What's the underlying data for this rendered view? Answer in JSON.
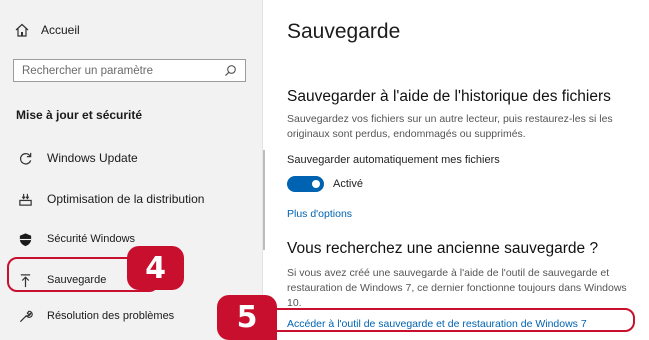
{
  "sidebar": {
    "home_label": "Accueil",
    "search_placeholder": "Rechercher un paramètre",
    "section_title": "Mise à jour et sécurité",
    "items": [
      {
        "label": "Windows Update",
        "icon": "sync-icon"
      },
      {
        "label": "Optimisation de la distribution",
        "icon": "delivery-optimization-icon"
      },
      {
        "label": "Sécurité Windows",
        "icon": "shield-icon"
      },
      {
        "label": "Sauvegarde",
        "icon": "backup-arrow-icon"
      },
      {
        "label": "Résolution des problèmes",
        "icon": "wrench-icon"
      }
    ]
  },
  "main": {
    "title": "Sauvegarde",
    "history_heading": "Sauvegarder à l'aide de l'historique des fichiers",
    "history_desc": "Sauvegardez vos fichiers sur un autre lecteur, puis restaurez-les si les originaux sont perdus, endommagés ou supprimés.",
    "auto_backup_label": "Sauvegarder automatiquement mes fichiers",
    "toggle_state": "Activé",
    "more_options": "Plus d'options",
    "old_backup_heading": "Vous recherchez une ancienne sauvegarde ?",
    "old_backup_desc": "Si vous avez créé une sauvegarde à l'aide de l'outil de sauvegarde et restauration de Windows 7, ce dernier fonctionne toujours dans Windows 10.",
    "restore_link": "Accéder à l'outil de sauvegarde et de restauration de Windows 7"
  },
  "annotations": {
    "step4": "4",
    "step5": "5",
    "color": "#c8102e"
  },
  "colors": {
    "accent": "#0063b1",
    "sidebar_bg": "#f2f2f2"
  }
}
